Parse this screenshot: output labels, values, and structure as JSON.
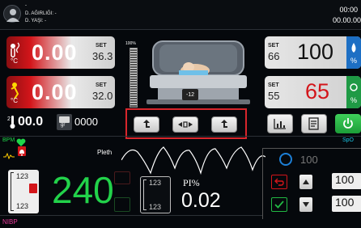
{
  "header": {
    "line1": "-",
    "weight_label": "D. AĞIRLIĞI: -",
    "age_label": "D. YAŞI: -",
    "time": "00:00",
    "date": "00.00.00"
  },
  "air_temp": {
    "value": "0.00",
    "set_label": "SET",
    "set_value": "36.3",
    "unit": "°C"
  },
  "skin_temp": {
    "value": "0.00",
    "set_label": "SET",
    "set_value": "32.0",
    "unit": "°C"
  },
  "secondary": {
    "temp_value": "00.0",
    "weight_unit": "gr",
    "weight_value": "0000"
  },
  "heater": {
    "percent_label": "100%",
    "level": 0.0
  },
  "incubator": {
    "display_value": "-12"
  },
  "tilt_controls": {
    "left_label": "",
    "center_label": "",
    "right_label": ""
  },
  "humidity": {
    "set_label": "SET",
    "set_value": "66",
    "value": "100",
    "unit": "%"
  },
  "oxygen": {
    "set_label": "SET",
    "set_value": "55",
    "value": "65",
    "unit": "%"
  },
  "spo2_panel": {
    "bpm_label": "BPM",
    "spo2_label": "SpO",
    "pleth_label": "Pleth",
    "pr_value": "240",
    "pr_limit_high": "123",
    "pr_limit_low": "123",
    "pi_label": "PI%",
    "pi_value": "0.02",
    "pi_limit_high": "123",
    "pi_limit_low": "123",
    "sat_circle_value": "100",
    "sat_upper": "100",
    "sat_lower": "100"
  },
  "nibp": {
    "label": "NIBP"
  },
  "colors": {
    "red": "#d3151a",
    "green": "#21a34a",
    "bpm_green": "#20d64a",
    "spo2_cyan": "#19c6e6",
    "nibp_magenta": "#e83a9a"
  },
  "icons": [
    "air-temperature-icon",
    "skin-temperature-icon",
    "thermometer-icon",
    "weight-scale-icon",
    "humidity-drop-icon",
    "oxygen-icon",
    "trend-chart-icon",
    "report-icon",
    "power-icon",
    "heart-icon",
    "alarm-bell-icon",
    "back-arrow-icon",
    "up-arrow-icon",
    "down-arrow-icon",
    "check-icon"
  ]
}
